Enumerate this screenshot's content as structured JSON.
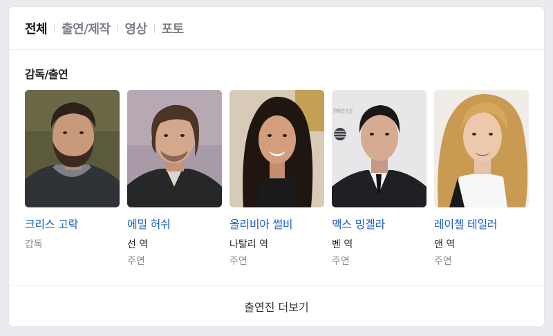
{
  "tabs": [
    {
      "label": "전체",
      "active": true
    },
    {
      "label": "출연/제작",
      "active": false
    },
    {
      "label": "영상",
      "active": false
    },
    {
      "label": "포토",
      "active": false
    }
  ],
  "section_title": "감독/출연",
  "people": [
    {
      "name": "크리스 고락",
      "role": "",
      "position": "감독",
      "photo": "person-photo"
    },
    {
      "name": "에밀 허쉬",
      "role": "선 역",
      "position": "주연",
      "photo": "person-photo"
    },
    {
      "name": "올리비아 썰비",
      "role": "나탈리 역",
      "position": "주연",
      "photo": "person-photo"
    },
    {
      "name": "맥스 밍겔라",
      "role": "벤 역",
      "position": "주연",
      "photo": "person-photo"
    },
    {
      "name": "레이첼 테일러",
      "role": "앤 역",
      "position": "주연",
      "photo": "person-photo"
    }
  ],
  "more_label": "출연진 더보기",
  "colors": {
    "link": "#1f5fbd",
    "muted": "#8a8f96",
    "active_tab": "#111111",
    "background": "#e9ebee"
  }
}
